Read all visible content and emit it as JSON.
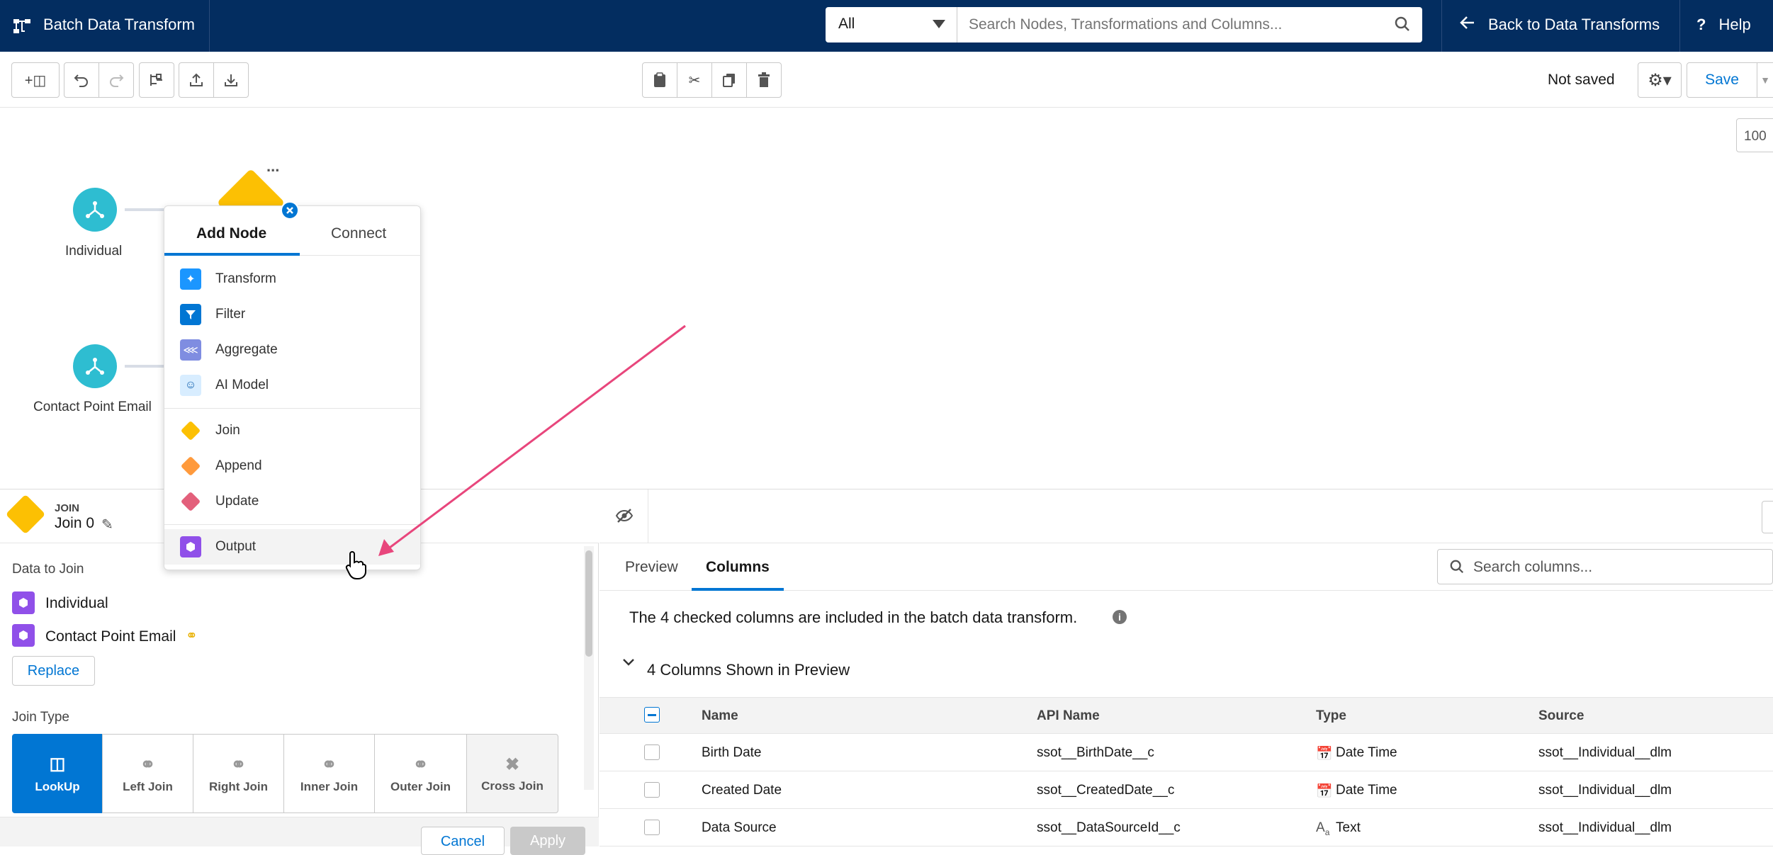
{
  "topbar": {
    "app_title": "Batch Data Transform",
    "filter_value": "All",
    "search_placeholder": "Search Nodes, Transformations and Columns...",
    "back_label": "Back to Data Transforms",
    "help_label": "Help"
  },
  "toolbar": {
    "status": "Not saved",
    "save_label": "Save",
    "zoom": "100"
  },
  "canvas": {
    "nodes": [
      {
        "label": "Individual"
      },
      {
        "label": "Contact Point Email"
      }
    ],
    "more_label": "..."
  },
  "add_menu": {
    "tabs": [
      "Add Node",
      "Connect"
    ],
    "items": [
      {
        "label": "Transform",
        "color": "#1b96ff"
      },
      {
        "label": "Filter",
        "color": "#0176d3"
      },
      {
        "label": "Aggregate",
        "color": "#7f8de1"
      },
      {
        "label": "AI Model",
        "color": "#d8edff"
      },
      {
        "label": "Join",
        "color": "#fcc003"
      },
      {
        "label": "Append",
        "color": "#ff9a3c"
      },
      {
        "label": "Update",
        "color": "#e3607b"
      },
      {
        "label": "Output",
        "color": "#9050e9"
      }
    ]
  },
  "node_panel": {
    "type_label": "JOIN",
    "node_name": "Join 0",
    "data_to_join_label": "Data to Join",
    "sources": [
      "Individual",
      "Contact Point Email"
    ],
    "replace_label": "Replace",
    "join_type_label": "Join Type",
    "join_types": [
      "LookUp",
      "Left Join",
      "Right Join",
      "Inner Join",
      "Outer Join",
      "Cross Join"
    ],
    "cancel_label": "Cancel",
    "apply_label": "Apply"
  },
  "preview_panel": {
    "tabs": [
      "Preview",
      "Columns"
    ],
    "search_placeholder": "Search columns...",
    "info_text": "The 4 checked columns are included in the batch data transform.",
    "section_label": "4 Columns Shown in Preview",
    "columns": [
      "Name",
      "API Name",
      "Type",
      "Source"
    ],
    "rows": [
      {
        "name": "Birth Date",
        "api": "ssot__BirthDate__c",
        "type": "Date Time",
        "source": "ssot__Individual__dlm"
      },
      {
        "name": "Created Date",
        "api": "ssot__CreatedDate__c",
        "type": "Date Time",
        "source": "ssot__Individual__dlm"
      },
      {
        "name": "Data Source",
        "api": "ssot__DataSourceId__c",
        "type": "Text",
        "source": "ssot__Individual__dlm"
      }
    ]
  }
}
